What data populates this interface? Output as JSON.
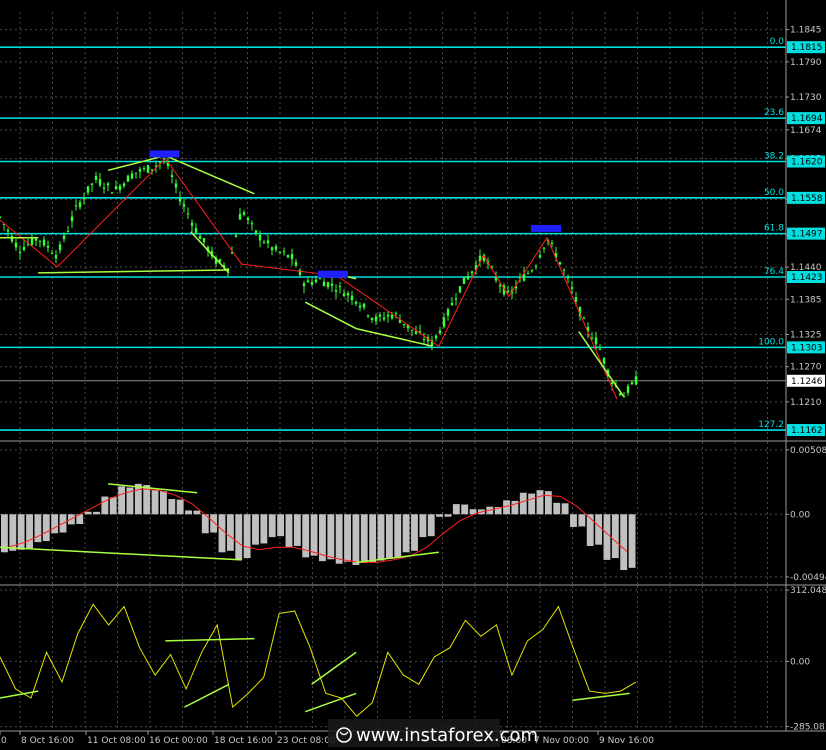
{
  "chart_data": [
    {
      "type": "candlestick",
      "panel": "price",
      "symbol": "EURUSD",
      "y_ticks": [
        1.1845,
        1.179,
        1.173,
        1.1674,
        1.1625,
        1.1555,
        1.1495,
        1.144,
        1.1385,
        1.1325,
        1.127,
        1.121
      ],
      "current_price": 1.1246,
      "ylim": [
        1.1145,
        1.1875
      ],
      "grid": true,
      "fib_levels": [
        {
          "label": "0.0",
          "price": 1.1815
        },
        {
          "label": "23.6",
          "price": 1.1694
        },
        {
          "label": "38.2",
          "price": 1.162
        },
        {
          "label": "50.0",
          "price": 1.1558
        },
        {
          "label": "61.8",
          "price": 1.1497
        },
        {
          "label": "76.4",
          "price": 1.1423
        },
        {
          "label": "100.0",
          "price": 1.1303
        },
        {
          "label": "127.2",
          "price": 1.1162
        }
      ],
      "zigzag": [
        {
          "t": 0.0,
          "p": 1.152
        },
        {
          "t": 0.09,
          "p": 1.144
        },
        {
          "t": 0.26,
          "p": 1.1625
        },
        {
          "t": 0.38,
          "p": 1.1445
        },
        {
          "t": 0.53,
          "p": 1.1425
        },
        {
          "t": 0.69,
          "p": 1.1305
        },
        {
          "t": 0.76,
          "p": 1.146
        },
        {
          "t": 0.8,
          "p": 1.139
        },
        {
          "t": 0.86,
          "p": 1.149
        },
        {
          "t": 0.97,
          "p": 1.1215
        }
      ],
      "price_path": [
        {
          "t": 0.0,
          "p": 1.1525
        },
        {
          "t": 0.03,
          "p": 1.147
        },
        {
          "t": 0.06,
          "p": 1.149
        },
        {
          "t": 0.09,
          "p": 1.146
        },
        {
          "t": 0.12,
          "p": 1.154
        },
        {
          "t": 0.15,
          "p": 1.159
        },
        {
          "t": 0.18,
          "p": 1.157
        },
        {
          "t": 0.21,
          "p": 1.16
        },
        {
          "t": 0.24,
          "p": 1.161
        },
        {
          "t": 0.26,
          "p": 1.1625
        },
        {
          "t": 0.28,
          "p": 1.1565
        },
        {
          "t": 0.31,
          "p": 1.15
        },
        {
          "t": 0.34,
          "p": 1.145
        },
        {
          "t": 0.36,
          "p": 1.144
        },
        {
          "t": 0.38,
          "p": 1.154
        },
        {
          "t": 0.4,
          "p": 1.15
        },
        {
          "t": 0.43,
          "p": 1.147
        },
        {
          "t": 0.46,
          "p": 1.1455
        },
        {
          "t": 0.48,
          "p": 1.141
        },
        {
          "t": 0.5,
          "p": 1.142
        },
        {
          "t": 0.53,
          "p": 1.1405
        },
        {
          "t": 0.56,
          "p": 1.1385
        },
        {
          "t": 0.59,
          "p": 1.135
        },
        {
          "t": 0.62,
          "p": 1.136
        },
        {
          "t": 0.65,
          "p": 1.133
        },
        {
          "t": 0.68,
          "p": 1.131
        },
        {
          "t": 0.7,
          "p": 1.135
        },
        {
          "t": 0.72,
          "p": 1.14
        },
        {
          "t": 0.74,
          "p": 1.143
        },
        {
          "t": 0.76,
          "p": 1.146
        },
        {
          "t": 0.78,
          "p": 1.142
        },
        {
          "t": 0.8,
          "p": 1.139
        },
        {
          "t": 0.82,
          "p": 1.142
        },
        {
          "t": 0.84,
          "p": 1.144
        },
        {
          "t": 0.86,
          "p": 1.149
        },
        {
          "t": 0.88,
          "p": 1.145
        },
        {
          "t": 0.9,
          "p": 1.14
        },
        {
          "t": 0.92,
          "p": 1.134
        },
        {
          "t": 0.94,
          "p": 1.131
        },
        {
          "t": 0.96,
          "p": 1.125
        },
        {
          "t": 0.98,
          "p": 1.122
        },
        {
          "t": 1.0,
          "p": 1.1246
        }
      ]
    },
    {
      "type": "histogram",
      "panel": "macd",
      "y_ticks": [
        0.00508,
        0.0,
        -0.00494
      ],
      "ylim": [
        -0.0055,
        0.0057
      ],
      "values": [
        -0.003,
        -0.0028,
        -0.0022,
        -0.0015,
        -0.0008,
        0.0002,
        0.0014,
        0.0022,
        0.0024,
        0.0019,
        0.0012,
        0.0003,
        -0.0015,
        -0.003,
        -0.0036,
        -0.0024,
        -0.0018,
        -0.0026,
        -0.0034,
        -0.0037,
        -0.0039,
        -0.004,
        -0.0038,
        -0.0035,
        -0.003,
        -0.0018,
        -0.0002,
        0.0008,
        0.0004,
        0.0006,
        0.0011,
        0.0017,
        0.0019,
        0.0009,
        -0.001,
        -0.0025,
        -0.0036,
        -0.0044
      ],
      "signal": [
        -0.0026,
        -0.0022,
        -0.0016,
        -0.0009,
        -0.0002,
        0.0005,
        0.0012,
        0.0017,
        0.002,
        0.0019,
        0.0015,
        0.0008,
        -0.0003,
        -0.0015,
        -0.0025,
        -0.0028,
        -0.0026,
        -0.0026,
        -0.0029,
        -0.0033,
        -0.0036,
        -0.0038,
        -0.0038,
        -0.0036,
        -0.0033,
        -0.0026,
        -0.0015,
        -0.0005,
        0.0001,
        0.0004,
        0.0007,
        0.0011,
        0.0015,
        0.0014,
        0.0006,
        -0.0006,
        -0.0018,
        -0.003
      ]
    },
    {
      "type": "line",
      "panel": "cci",
      "y_ticks": [
        312.048,
        0.0,
        -285.081
      ],
      "ylim": [
        -300,
        330
      ],
      "values": [
        20,
        -120,
        -160,
        40,
        -90,
        120,
        250,
        160,
        240,
        60,
        -60,
        30,
        -120,
        40,
        160,
        -200,
        -140,
        -70,
        210,
        220,
        60,
        -140,
        -160,
        -240,
        -180,
        40,
        -60,
        -100,
        20,
        60,
        180,
        110,
        160,
        -60,
        90,
        140,
        240,
        50,
        -130,
        -140,
        -130,
        -90
      ]
    }
  ],
  "time_labels": [
    "0",
    "8 Oct 16:00",
    "11 Oct 08:00",
    "16 Oct 00:00",
    "18 Oct 16:00",
    "23 Oct 08:00",
    "08:00",
    "7 Nov 00:00",
    "9 Nov 16:00"
  ],
  "watermark": "www.instaforex.com",
  "colors": {
    "background": "#000000",
    "grid": "#4a4a4a",
    "candle": "#33ff33",
    "fib": "#00e0e0",
    "zigzag": "#ff2020",
    "trendline": "#a8ff40",
    "box": "#2020ff",
    "histogram": "#c0c0c0",
    "signal": "#ff2020",
    "cci": "#e6e600",
    "axis_text": "#c8c8c8"
  }
}
